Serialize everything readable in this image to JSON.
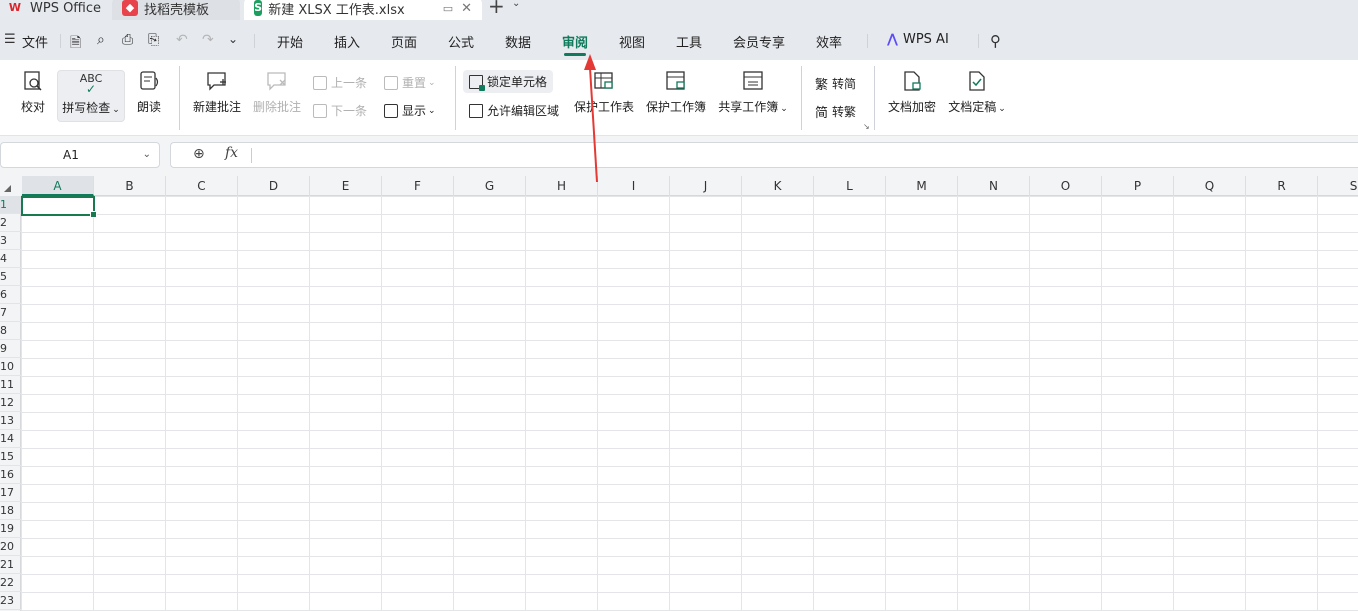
{
  "tabs": [
    {
      "label": "WPS Office",
      "icon": "wps-logo-icon",
      "color": "#d9262c"
    },
    {
      "label": "找稻壳模板",
      "icon": "daoke-icon",
      "color": "#e8434b"
    },
    {
      "label": "新建 XLSX 工作表.xlsx",
      "icon": "spreadsheet-icon",
      "color": "#1b9e5e",
      "badge": "S"
    }
  ],
  "menu": {
    "file": "文件",
    "items": [
      "开始",
      "插入",
      "页面",
      "公式",
      "数据",
      "审阅",
      "视图",
      "工具",
      "会员专享",
      "效率"
    ],
    "active": "审阅",
    "ai": "WPS AI"
  },
  "ribbon": {
    "proofread": "校对",
    "spellcheck_abc": "ABC",
    "spellcheck": "拼写检查",
    "read_aloud": "朗读",
    "new_comment": "新建批注",
    "delete_comment": "删除批注",
    "prev": "上一条",
    "next": "下一条",
    "reset": "重置",
    "show": "显示",
    "lock_cells": "锁定单元格",
    "allow_edit_ranges": "允许编辑区域",
    "protect_sheet": "保护工作表",
    "protect_workbook": "保护工作簿",
    "share_workbook": "共享工作簿",
    "to_simplified": "转简",
    "to_traditional": "转繁",
    "trad_glyph": "繁",
    "simp_glyph": "简",
    "encrypt": "文档加密",
    "finalize": "文档定稿"
  },
  "formula_bar": {
    "cell_ref": "A1",
    "fx": "fx",
    "value": ""
  },
  "sheet": {
    "columns": [
      "A",
      "B",
      "C",
      "D",
      "E",
      "F",
      "G",
      "H",
      "I",
      "J",
      "K",
      "L",
      "M",
      "N",
      "O",
      "P",
      "Q",
      "R",
      "S"
    ],
    "rows": [
      "1",
      "2",
      "3",
      "4",
      "5",
      "6",
      "7",
      "8",
      "9",
      "10",
      "11",
      "12",
      "13",
      "14",
      "15",
      "16",
      "17",
      "18",
      "19",
      "20",
      "21",
      "22",
      "23"
    ],
    "selected_cell": "A1"
  },
  "colors": {
    "accent": "#0f7a5c",
    "annotation_arrow": "#e53935"
  }
}
